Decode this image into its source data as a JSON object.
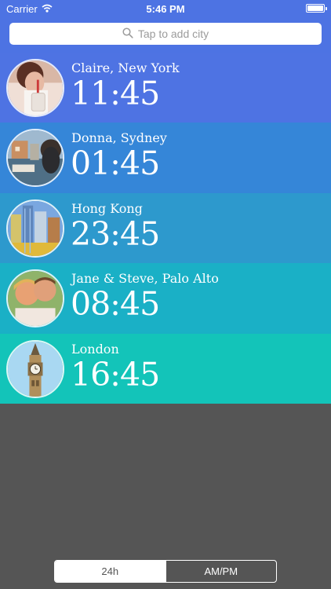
{
  "status_bar": {
    "carrier": "Carrier",
    "time": "5:46 PM",
    "battery_level": 1.0
  },
  "search": {
    "placeholder": "Tap to add city",
    "icon": "search-icon"
  },
  "cities": [
    {
      "label": "Claire, New York",
      "time": "11:45",
      "color": "#4e73e3",
      "photo": "claire-photo"
    },
    {
      "label": "Donna, Sydney",
      "time": "01:45",
      "color": "#3586d8",
      "photo": "donna-photo"
    },
    {
      "label": "Hong Kong",
      "time": "23:45",
      "color": "#2d99cd",
      "photo": "hong-kong-photo"
    },
    {
      "label": "Jane & Steve, Palo Alto",
      "time": "08:45",
      "color": "#1ab0c6",
      "photo": "jane-steve-photo"
    },
    {
      "label": "London",
      "time": "16:45",
      "color": "#13c4b9",
      "photo": "london-photo"
    }
  ],
  "format_toggle": {
    "option_24h": "24h",
    "option_ampm": "AM/PM",
    "selected": "24h"
  },
  "colors": {
    "background": "#555555",
    "header": "#4d73e3",
    "white": "#ffffff"
  }
}
